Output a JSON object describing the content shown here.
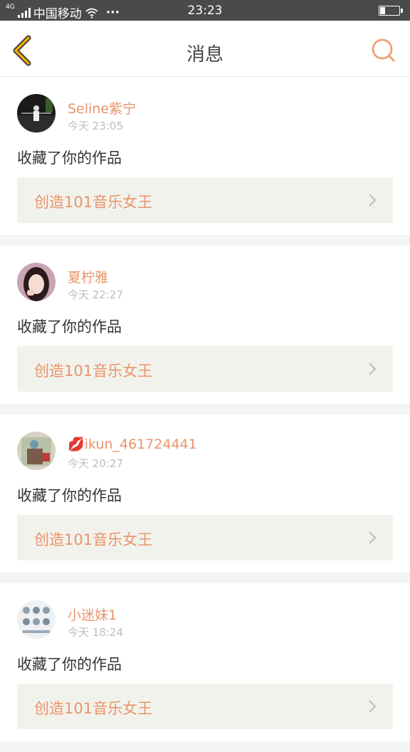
{
  "status_bar": {
    "network_tag": "4G",
    "carrier": "中国移动",
    "more": "···",
    "time": "23:23",
    "battery_level": 0.25
  },
  "nav": {
    "back_icon": "chevron-left-icon",
    "title": "消息",
    "search_icon": "search-icon",
    "accent_color": "#f2a900",
    "search_color": "#f0a070"
  },
  "messages": [
    {
      "user": "Seline紫宁",
      "time": "今天 23:05",
      "action": "收藏了你的作品",
      "work_title": "创造101音乐女王"
    },
    {
      "user": "夏柠雅",
      "time": "今天 22:27",
      "action": "收藏了你的作品",
      "work_title": "创造101音乐女王"
    },
    {
      "user": "💋ikun_461724441",
      "time": "今天 20:27",
      "action": "收藏了你的作品",
      "work_title": "创造101音乐女王"
    },
    {
      "user": "小迷妹1",
      "time": "今天 18:24",
      "action": "收藏了你的作品",
      "work_title": "创造101音乐女王"
    }
  ]
}
